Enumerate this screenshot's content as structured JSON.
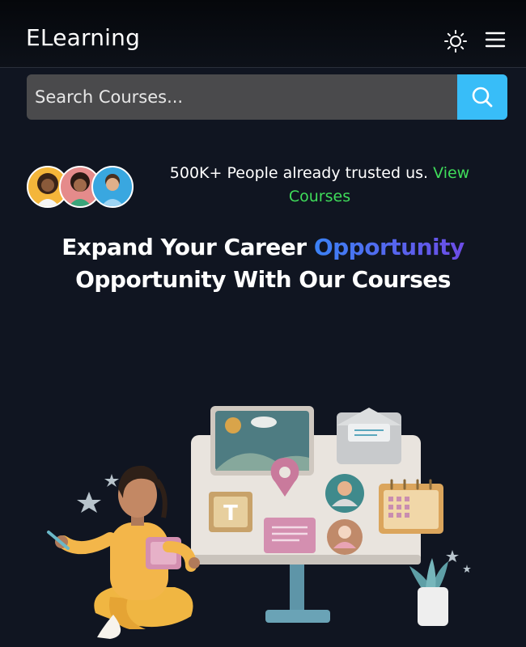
{
  "header": {
    "brand": "ELearning",
    "theme_toggle_icon": "sun-icon",
    "menu_icon": "hamburger-menu-icon"
  },
  "search": {
    "placeholder": "Search Courses...",
    "button_icon": "search-icon",
    "accent_color": "#38bdf8"
  },
  "trust": {
    "text": "500K+ People already trusted us.",
    "link_label": "View Courses",
    "link_color": "#3fdc5a",
    "avatar_count": 3
  },
  "hero": {
    "title_part1": "Expand Your Career",
    "title_accent": "Opportunity",
    "title_part2": "Opportunity With Our Courses"
  },
  "illustration": {
    "letter_tile": "T"
  }
}
